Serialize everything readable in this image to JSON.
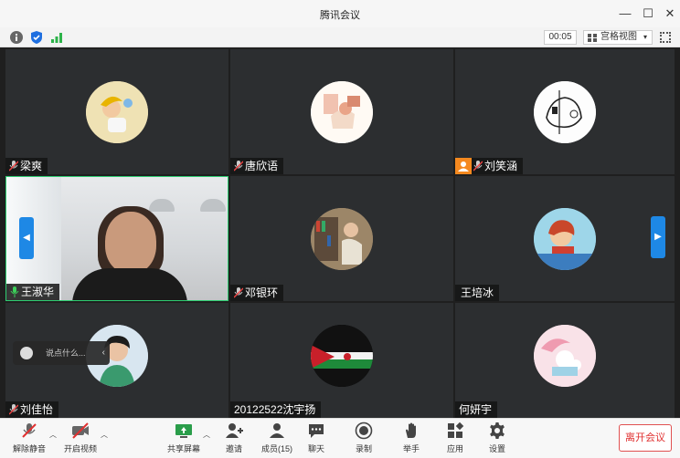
{
  "window": {
    "title": "腾讯会议"
  },
  "toolbar": {
    "timer": "00:05",
    "view_label": "宫格视图"
  },
  "participants": [
    {
      "name": "梁爽"
    },
    {
      "name": "唐欣语"
    },
    {
      "name": "刘笑涵"
    },
    {
      "name": "王淑华"
    },
    {
      "name": "邓银环"
    },
    {
      "name": "王培冰"
    },
    {
      "name": "刘佳怡"
    },
    {
      "name": "20122522沈宇扬"
    },
    {
      "name": "何妍宇"
    }
  ],
  "chat": {
    "placeholder": "说点什么..."
  },
  "bottombar": {
    "unmute": "解除静音",
    "start_video": "开启视频",
    "share_screen": "共享屏幕",
    "invite": "邀请",
    "members": "成员(15)",
    "chat": "聊天",
    "record": "录制",
    "raise_hand": "举手",
    "apps": "应用",
    "settings": "设置",
    "leave": "离开会议"
  },
  "colors": {
    "accent": "#1e88e5",
    "leave": "#e03030",
    "active_border": "#2ecc71"
  }
}
